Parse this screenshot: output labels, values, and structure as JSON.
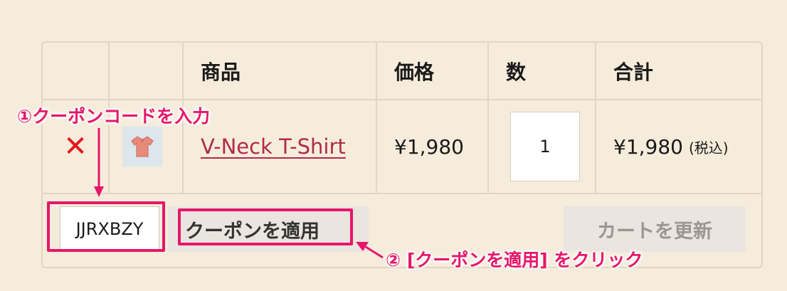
{
  "table": {
    "headers": [
      "",
      "",
      "商品",
      "価格",
      "数",
      "合計"
    ],
    "item": {
      "remove_symbol": "✕",
      "product_name": "V-Neck T-Shirt",
      "price": "¥1,980",
      "quantity": "1",
      "subtotal": "¥1,980",
      "tax_note": "(税込)"
    }
  },
  "coupon": {
    "code_value": "JJRXBZY",
    "apply_label": "クーポンを適用"
  },
  "cart": {
    "update_label": "カートを更新"
  },
  "annotations": {
    "step1": "①クーポンコードを入力",
    "step2": "② [クーポンを適用] をクリック"
  },
  "colors": {
    "background": "#f5ecdc",
    "accent_annotation": "#e5176a",
    "link": "#b22a4a",
    "remove": "#e3161a"
  }
}
